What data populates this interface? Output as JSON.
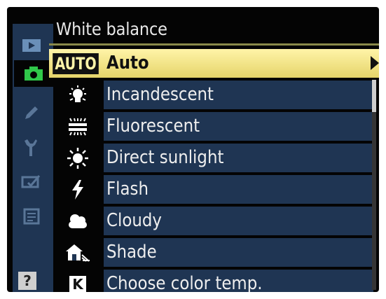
{
  "title": "White balance",
  "menu": {
    "items": [
      {
        "label": "Auto",
        "icon": "AUTO",
        "icon_name": "auto-wb-icon"
      },
      {
        "label": "Incandescent",
        "icon_name": "incandescent-icon"
      },
      {
        "label": "Fluorescent",
        "icon_name": "fluorescent-icon"
      },
      {
        "label": "Direct sunlight",
        "icon_name": "sun-icon"
      },
      {
        "label": "Flash",
        "icon_name": "flash-icon"
      },
      {
        "label": "Cloudy",
        "icon_name": "cloud-icon"
      },
      {
        "label": "Shade",
        "icon_name": "shade-icon"
      },
      {
        "label": "Choose color temp.",
        "icon": "K",
        "icon_name": "kelvin-icon"
      }
    ],
    "selected_index": 0
  },
  "tabs": [
    "playback",
    "shooting",
    "custom-settings",
    "setup",
    "retouch",
    "recent-settings"
  ],
  "help": "?",
  "colors": {
    "accent": "#f2e27e",
    "bar": "#1f3553"
  }
}
